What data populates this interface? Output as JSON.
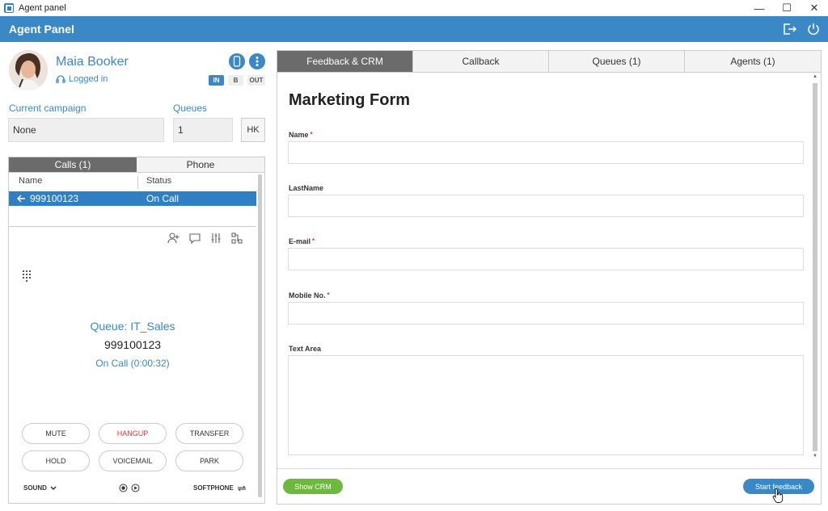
{
  "window": {
    "title": "Agent panel"
  },
  "header": {
    "title": "Agent Panel",
    "accent": "#3a88c6"
  },
  "agent": {
    "name": "Maia Booker",
    "status": "Logged in",
    "modes": [
      "IN",
      "B",
      "OUT"
    ],
    "active_mode": "IN"
  },
  "campaign": {
    "label": "Current campaign",
    "value": "None"
  },
  "queues": {
    "label": "Queues",
    "value": "1",
    "hk_label": "HK"
  },
  "left_tabs": [
    {
      "label": "Calls (1)",
      "active": true
    },
    {
      "label": "Phone",
      "active": false
    }
  ],
  "calls_table": {
    "columns": [
      "Name",
      "Status"
    ],
    "rows": [
      {
        "name": "999100123",
        "status": "On Call"
      }
    ]
  },
  "active_call": {
    "queue": "Queue: IT_Sales",
    "number": "999100123",
    "state": "On Call (0:00:32)"
  },
  "call_buttons": {
    "mute": "MUTE",
    "hangup": "HANGUP",
    "transfer": "TRANSFER",
    "hold": "HOLD",
    "voicemail": "VOICEMAIL",
    "park": "PARK"
  },
  "call_footer": {
    "sound": "SOUND",
    "softphone": "SOFTPHONE"
  },
  "right_tabs": [
    {
      "label": "Feedback & CRM",
      "active": true
    },
    {
      "label": "Callback",
      "active": false
    },
    {
      "label": "Queues (1)",
      "active": false
    },
    {
      "label": "Agents (1)",
      "active": false
    }
  ],
  "form": {
    "title": "Marketing Form",
    "fields": {
      "name": {
        "label": "Name",
        "required": "*"
      },
      "lastname": {
        "label": "LastName"
      },
      "email": {
        "label": "E-mail",
        "required": "*"
      },
      "mobile": {
        "label": "Mobile No.",
        "required": "*"
      },
      "textarea": {
        "label": "Text Area"
      }
    }
  },
  "footer": {
    "show_crm": "Show CRM",
    "start_feedback": "Start feedback"
  },
  "icons": [
    "minimize-icon",
    "maximize-icon",
    "close-icon",
    "logout-icon",
    "power-icon",
    "phone-icon",
    "more-icon",
    "headset-icon",
    "add-contact-icon",
    "chat-icon",
    "settings-sliders-icon",
    "transfer-network-icon",
    "dialpad-icon",
    "record-icon",
    "play-icon",
    "chevron-down-icon",
    "arrow-left-icon"
  ]
}
